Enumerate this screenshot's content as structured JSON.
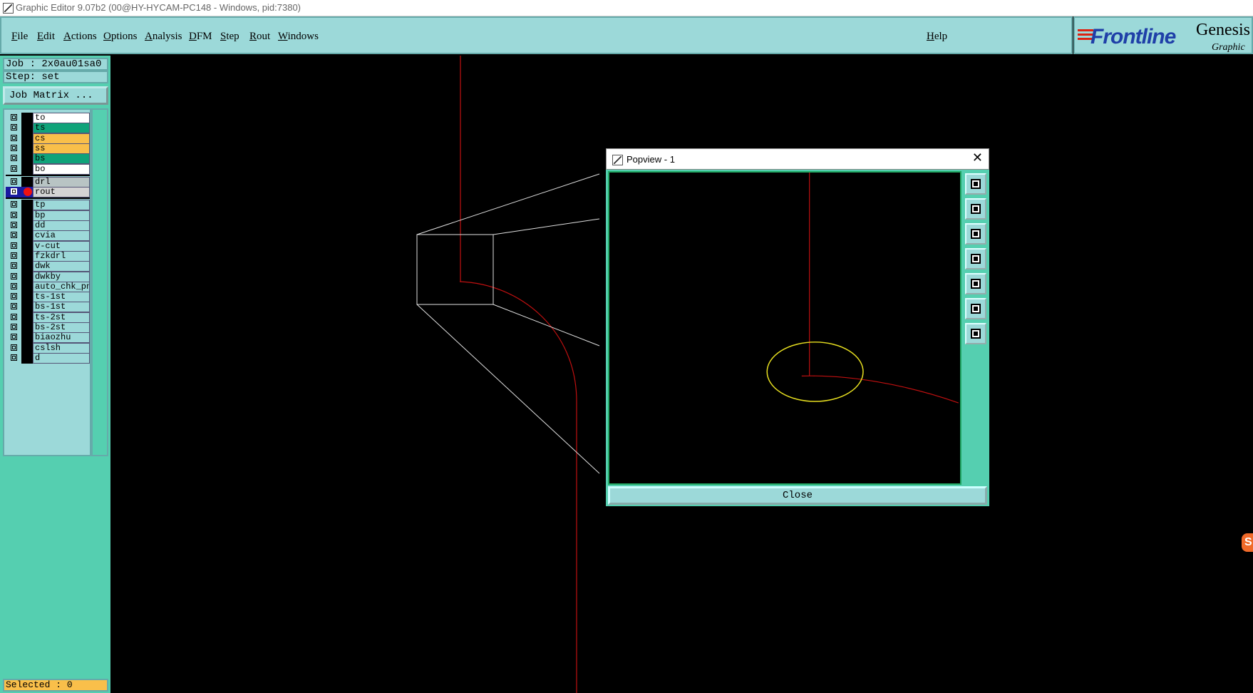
{
  "window": {
    "title": "Graphic Editor 9.07b2 (00@HY-HYCAM-PC148 - Windows, pid:7380)"
  },
  "menubar": {
    "items": [
      "File",
      "Edit",
      "Actions",
      "Options",
      "Analysis",
      "DFM",
      "Step",
      "Rout",
      "Windows"
    ],
    "help": "Help"
  },
  "logo": {
    "brand": "Frontline",
    "product": "Genesis",
    "subtitle": "Graphic E"
  },
  "left_panel": {
    "job": "Job : 2x0au01sa0",
    "step": "Step: set",
    "job_matrix": "Job Matrix ...",
    "selected": "Selected : 0"
  },
  "layers": [
    {
      "name": "to",
      "color": "#ffffff"
    },
    {
      "name": "ts",
      "color": "#0fa37a"
    },
    {
      "name": "cs",
      "color": "#f9bf4a"
    },
    {
      "name": "ss",
      "color": "#f9bf4a"
    },
    {
      "name": "bs",
      "color": "#0fa37a"
    },
    {
      "name": "bo",
      "color": "#ffffff"
    },
    {
      "name": "drl",
      "color": "#b8c4c4"
    },
    {
      "name": "rout",
      "color": "#d4d4d4",
      "active": true
    },
    {
      "name": "tp",
      "color": "#9cd9d9"
    },
    {
      "name": "bp",
      "color": "#9cd9d9"
    },
    {
      "name": "dd",
      "color": "#9cd9d9"
    },
    {
      "name": "cvia",
      "color": "#9cd9d9"
    },
    {
      "name": "v-cut",
      "color": "#9cd9d9"
    },
    {
      "name": "fzkdrl",
      "color": "#9cd9d9"
    },
    {
      "name": "dwk",
      "color": "#9cd9d9"
    },
    {
      "name": "dwkby",
      "color": "#9cd9d9"
    },
    {
      "name": "auto_chk_pnl",
      "color": "#9cd9d9"
    },
    {
      "name": "ts-1st",
      "color": "#9cd9d9"
    },
    {
      "name": "bs-1st",
      "color": "#9cd9d9"
    },
    {
      "name": "ts-2st",
      "color": "#9cd9d9"
    },
    {
      "name": "bs-2st",
      "color": "#9cd9d9"
    },
    {
      "name": "biaozhu",
      "color": "#9cd9d9"
    },
    {
      "name": "cslsh",
      "color": "#9cd9d9"
    },
    {
      "name": "d",
      "color": "#9cd9d9"
    }
  ],
  "popview": {
    "title": "Popview - 1",
    "close_label": "Close",
    "tools": [
      "zoom-home-icon",
      "pan-up-icon",
      "pan-down-icon",
      "pan-left-icon",
      "pan-right-icon",
      "zoom-in-icon",
      "zoom-out-icon"
    ]
  },
  "colors": {
    "panel_teal": "#55cfb0",
    "menu_teal": "#9cd9d9",
    "rout_line": "#c01010",
    "highlight_ellipse": "#e8e020",
    "zoom_frame": "#ffffff"
  },
  "side_mark": "S"
}
